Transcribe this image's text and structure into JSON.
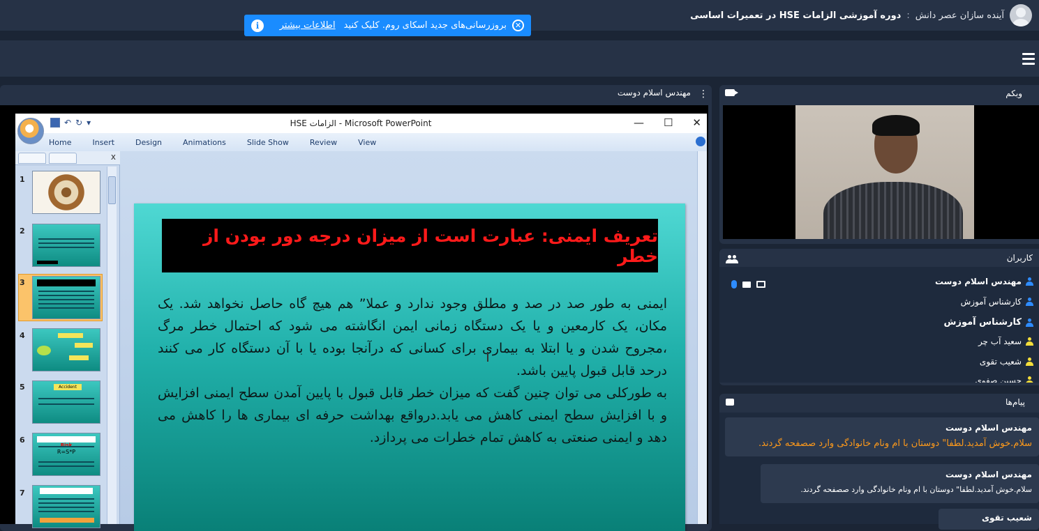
{
  "header": {
    "org": "آینده سازان عصر دانش",
    "separator": ":",
    "course": "دوره آموزشی الزامات HSE در تعمیرات اساسی"
  },
  "notice": {
    "close_glyph": "✕",
    "text": "بروزرسانی‌های جدید اسکای روم. کلیک کنید",
    "link": "اطلاعات بیشتر",
    "info_glyph": "i"
  },
  "presentation": {
    "presenter": "مهندس اسلام دوست",
    "menu_glyph": "⋮"
  },
  "powerpoint": {
    "window_title": "HSE الزامات - Microsoft PowerPoint",
    "qat_undo": "↶",
    "qat_redo": "↻",
    "qat_more": "▾",
    "minimize": "—",
    "maximize": "☐",
    "close": "✕",
    "ribbon_tabs": [
      "Home",
      "Insert",
      "Design",
      "Animations",
      "Slide Show",
      "Review",
      "View"
    ],
    "pane_close": "x",
    "slide_numbers": [
      "1",
      "2",
      "3",
      "4",
      "5",
      "6",
      "7"
    ],
    "thumb_5_label": "Accident",
    "thumb_6_label": "Risk",
    "thumb_6_formula": "R=S*P"
  },
  "slide": {
    "title": "تعریف ایمنی: عبارت است از میزان درجه دور بودن از خطر",
    "paragraph_1": "ایمنی به طور صد در صد و مطلق وجود ندارد و عملا” هم هیچ  گاه حاصل نخواهد شد. یک مکان، یک کارمعین و یا یک دستگاه زمانی ایمن انگاشته می شود که احتمال خطر مرگ ،مجروح شدن و یا ابتلا به بیماری برای کسانی که درآنجا بوده یا با آن دستگاه کار می کنند درحد قابل قبول پایین باشد.",
    "paragraph_2": "به طورکلی می توان چنین گفت که میزان خطر قابل قبول با پایین آمدن سطح ایمنی افزایش و با افزایش سطح ایمنی کاهش می یابد.درواقع بهداشت حرفه ای بیماری ها را کاهش می دهد و ایمنی صنعتی به کاهش تمام خطرات می پردازد."
  },
  "webcam": {
    "title": "وبکم"
  },
  "users": {
    "title": "کاربران",
    "list": [
      {
        "name": "مهندس اسلام دوست",
        "role": "presenter"
      },
      {
        "name": "کارشناس آموزش",
        "role": "admin"
      },
      {
        "name": "کارشناس آموزش",
        "role": "admin-self"
      },
      {
        "name": "سعید آب چر",
        "role": "guest"
      },
      {
        "name": "شعیب تقوی",
        "role": "guest"
      },
      {
        "name": "حسین صفوی",
        "role": "guest"
      }
    ]
  },
  "messages": {
    "title": "پیام‌ها",
    "items": [
      {
        "sender": "مهندس اسلام دوست",
        "text": "سلام.خوش آمدید.لطفا\" دوستان با ام ونام خانوادگی وارد صصفحه گردند.",
        "color": "#ff9a1a"
      },
      {
        "sender": "مهندس اسلام دوست",
        "text": "سلام.خوش آمدید.لطفا\" دوستان با ام ونام خانوادگی وارد صصفحه گردند.",
        "color": "#ffffff"
      },
      {
        "sender": "شعیب تقوی",
        "text": "",
        "color": "#ffffff"
      }
    ]
  },
  "colors": {
    "accent_blue": "#1a8cff",
    "panel_bg": "#263246",
    "slide_title_red": "#ff1a1a",
    "user_admin_yellow": "#f3dd3a"
  }
}
